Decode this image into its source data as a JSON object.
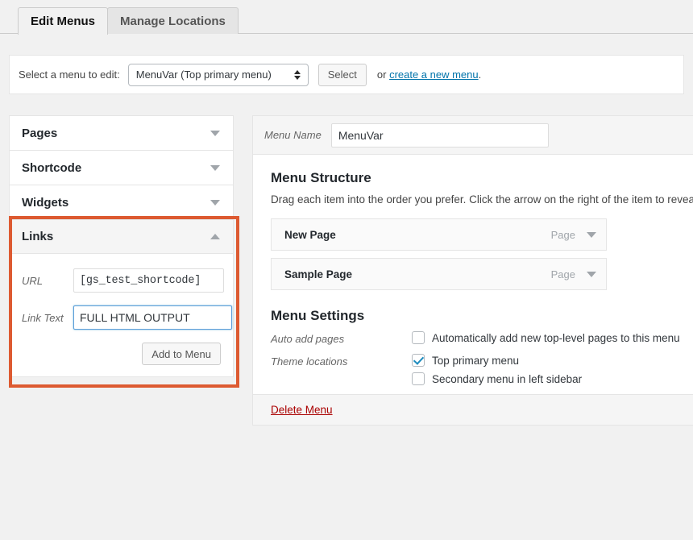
{
  "tabs": [
    {
      "label": "Edit Menus",
      "active": true
    },
    {
      "label": "Manage Locations",
      "active": false
    }
  ],
  "select_bar": {
    "label": "Select a menu to edit:",
    "selected_menu": "MenuVar (Top primary menu)",
    "select_button": "Select",
    "or_prefix": "or ",
    "create_link": "create a new menu",
    "or_suffix": "."
  },
  "accordion": {
    "panels": [
      {
        "title": "Pages",
        "open": false
      },
      {
        "title": "Shortcode",
        "open": false
      },
      {
        "title": "Widgets",
        "open": false
      },
      {
        "title": "Links",
        "open": true
      }
    ],
    "links_form": {
      "url_label": "URL",
      "url_value": "[gs_test_shortcode]",
      "link_text_label": "Link Text",
      "link_text_value": "FULL HTML OUTPUT",
      "add_button": "Add to Menu"
    },
    "highlight_color": "#dd5a31"
  },
  "right_panel": {
    "menu_name_label": "Menu Name",
    "menu_name_value": "MenuVar",
    "structure_heading": "Menu Structure",
    "structure_description": "Drag each item into the order you prefer. Click the arrow on the right of the item to reveal a",
    "menu_items": [
      {
        "title": "New Page",
        "type": "Page"
      },
      {
        "title": "Sample Page",
        "type": "Page"
      }
    ],
    "settings_heading": "Menu Settings",
    "auto_add_label": "Auto add pages",
    "auto_add_option": "Automatically add new top-level pages to this menu",
    "auto_add_checked": false,
    "theme_locations_label": "Theme locations",
    "theme_locations": [
      {
        "label": "Top primary menu",
        "checked": true
      },
      {
        "label": "Secondary menu in left sidebar",
        "checked": false
      }
    ],
    "delete_link": "Delete Menu"
  }
}
